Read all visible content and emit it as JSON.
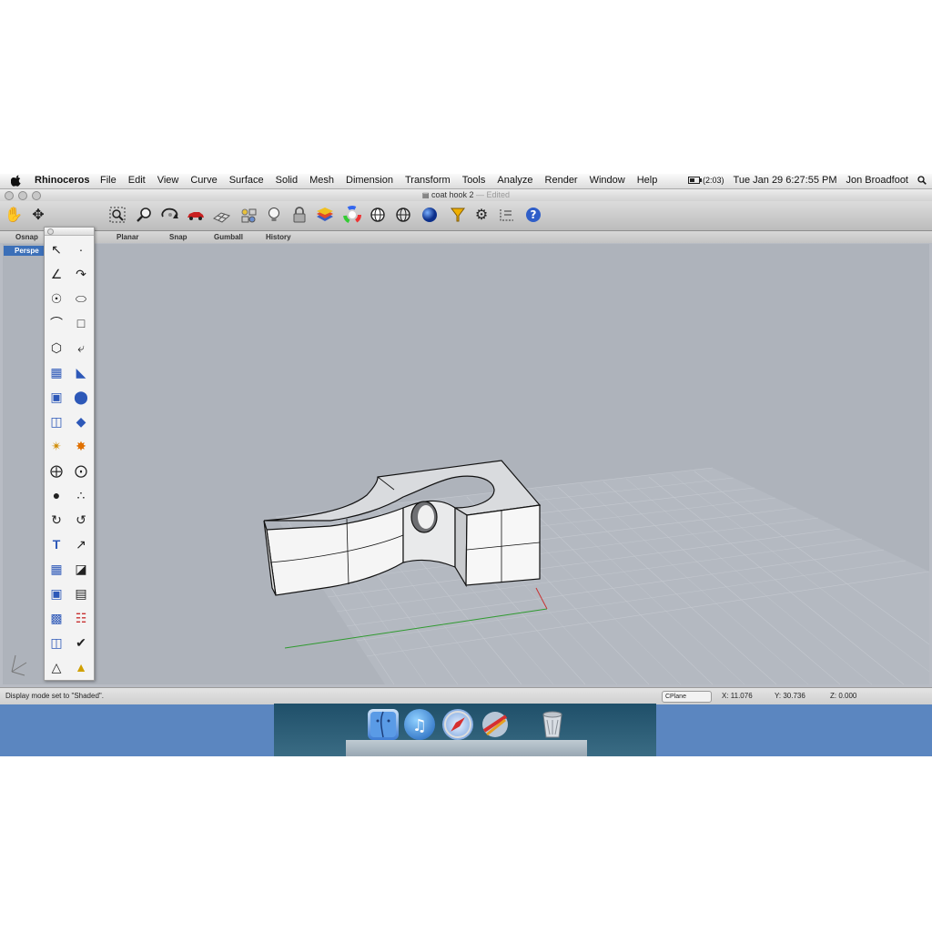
{
  "menubar": {
    "app_name": "Rhinoceros",
    "menus": [
      "File",
      "Edit",
      "View",
      "Curve",
      "Surface",
      "Solid",
      "Mesh",
      "Dimension",
      "Transform",
      "Tools",
      "Analyze",
      "Render",
      "Window",
      "Help"
    ],
    "battery": "(2:03)",
    "clock": "Tue Jan 29  6:27:55 PM",
    "user": "Jon Broadfoot"
  },
  "window": {
    "title": "coat hook 2",
    "status_suffix": "— Edited"
  },
  "tabs": [
    "Osnap",
    "Planar",
    "Snap",
    "Gumball",
    "History"
  ],
  "viewport": {
    "label": "Perspe"
  },
  "statusbar": {
    "message": "Display mode set to \"Shaded\".",
    "cplane": "CPlane",
    "x": "X: 11.076",
    "y": "Y: 30.736",
    "z": "Z: 0.000"
  },
  "toolbar_icons": [
    "hand-pan-icon",
    "move-icon",
    "zoom-window-icon",
    "zoom-icon",
    "rotate-view-icon",
    "car-icon",
    "grid-icon",
    "named-views-icon",
    "light-bulb-icon",
    "lock-icon",
    "layers-icon",
    "color-wheel-icon",
    "sphere-wire-icon",
    "sphere-shaded-icon",
    "render-sphere-icon",
    "funnel-icon",
    "gear-icon",
    "dimension-icon",
    "help-icon"
  ],
  "colors": {
    "viewport_bg": "#aeb3bb",
    "accent": "#3b6fb8",
    "axis_x": "#cc3333",
    "axis_y": "#33aa33"
  }
}
